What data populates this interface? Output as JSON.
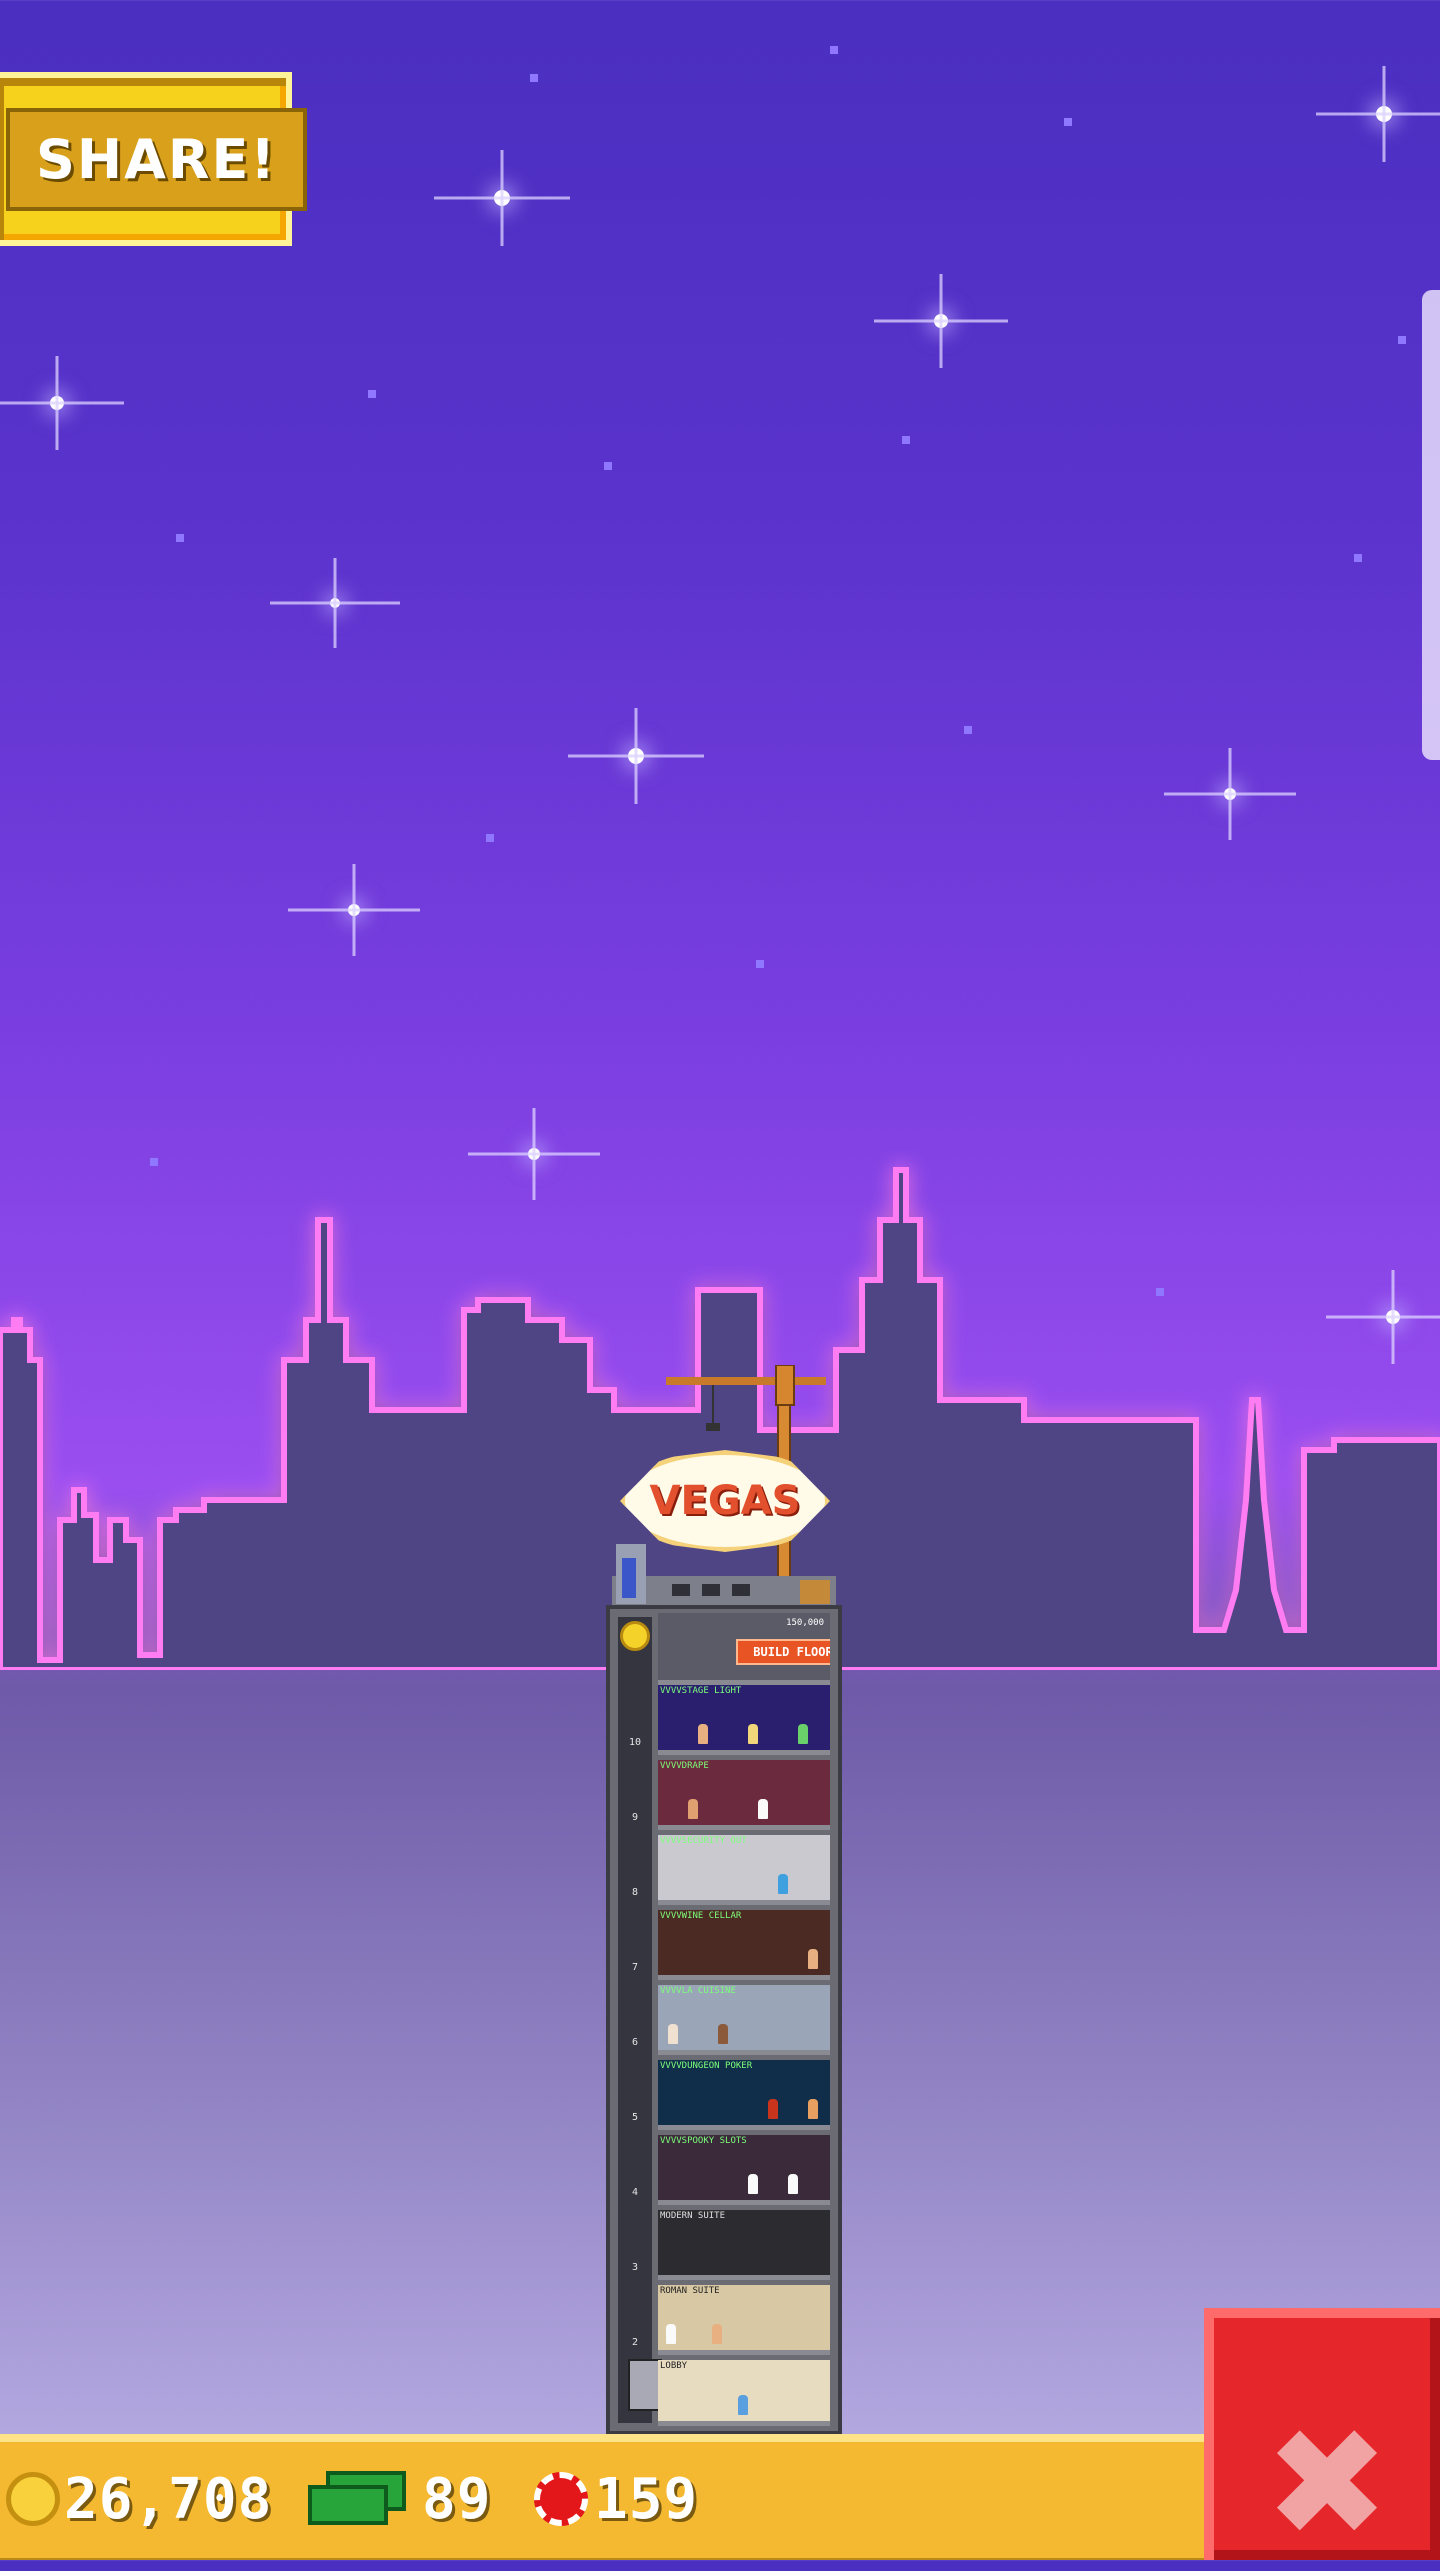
{
  "share": {
    "label": "SHARE!"
  },
  "sign": {
    "text": "VEGAS"
  },
  "tower": {
    "build_floor_label": "BUILD FLOOR",
    "build_floor_cost": "150,000",
    "floors": [
      {
        "name": "VVVVSTAGE LIGHT",
        "room_color": "#2a1f6e"
      },
      {
        "name": "VVVVDRAPE",
        "room_color": "#6b2a3e"
      },
      {
        "name": "VVVVSECURITY OUT",
        "room_color": "#c9c9cf"
      },
      {
        "name": "VVVVWINE CELLAR",
        "room_color": "#4b2a24"
      },
      {
        "name": "VVVVLA CUISINE",
        "room_color": "#9aa6b8"
      },
      {
        "name": "VVVVDUNGEON POKER",
        "room_color": "#102e4a"
      },
      {
        "name": "VVVVSPOOKY SLOTS",
        "room_color": "#3a2a3a"
      },
      {
        "name": "MODERN SUITE",
        "room_color": "#2b2b30"
      },
      {
        "name": "ROMAN SUITE",
        "room_color": "#d8c9a4"
      },
      {
        "name": "LOBBY",
        "room_color": "#e8dcc0"
      }
    ]
  },
  "currency": {
    "coins": "26,708",
    "bux": "89",
    "chips": "159"
  },
  "icons": {
    "coin": "coin-icon",
    "bux": "bux-icon",
    "chip": "chip-icon",
    "close": "close-icon",
    "elevator": "elevator-icon"
  },
  "colors": {
    "hud_bg": "#f4b930",
    "close_bg": "#e5262b",
    "share_bg": "#f7d21c",
    "sky_top": "#4a2fc0",
    "sky_bottom": "#c3b8ee"
  },
  "close_button": {
    "label": "✖"
  }
}
